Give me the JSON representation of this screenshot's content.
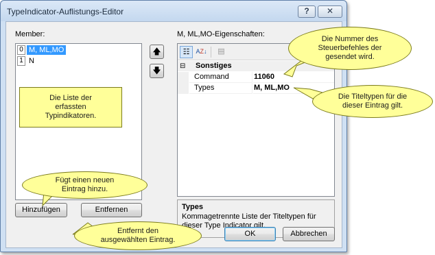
{
  "window": {
    "title": "TypeIndicator-Auflistungs-Editor",
    "help_label": "?",
    "close_label": "X"
  },
  "members": {
    "label": "Member:",
    "items": [
      {
        "index": "0",
        "text": "M, ML,MO",
        "selected": true
      },
      {
        "index": "1",
        "text": "N",
        "selected": false
      }
    ],
    "move_up_icon": "arrow-up",
    "move_down_icon": "arrow-down"
  },
  "properties": {
    "label": "M, ML,MO-Eigenschaften:",
    "category_toggle": "⊟",
    "category": "Sonstiges",
    "rows": [
      {
        "name": "Command",
        "value": "11060"
      },
      {
        "name": "Types",
        "value": "M, ML,MO"
      }
    ]
  },
  "description": {
    "title": "Types",
    "text": "Kommagetrennte Liste der Titeltypen für dieser Type Indicator gilt."
  },
  "buttons": {
    "add": "Hinzufügen",
    "remove": "Entfernen",
    "ok": "OK",
    "cancel": "Abbrechen"
  },
  "callouts": {
    "list": "Die Liste der erfassten Typindikatoren.",
    "command": "Die Nummer des Steuerbefehles der gesendet wird.",
    "types": "Die Titeltypen für die dieser Eintrag gilt.",
    "add": "Fügt einen neuen Eintrag hinzu.",
    "remove": "Entfernt den ausgewählten Eintrag."
  },
  "colors": {
    "selection": "#3399ff",
    "callout_fill": "#ffff99",
    "window_frame": "#cfe0f3"
  }
}
